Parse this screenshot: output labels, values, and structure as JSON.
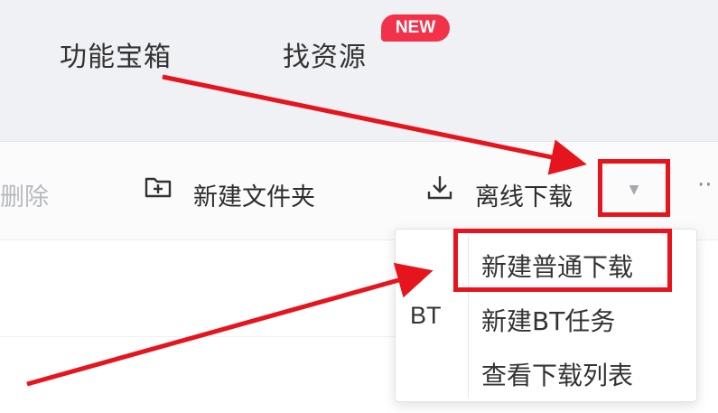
{
  "topnav": {
    "items": [
      {
        "label": "功能宝箱"
      },
      {
        "label": "找资源",
        "badge": "NEW"
      }
    ]
  },
  "toolbar": {
    "delete_label": "删除",
    "new_folder_label": "新建文件夹",
    "offline_download_label": "离线下载",
    "more_label": "··"
  },
  "dropdown": {
    "items": [
      {
        "label": "新建普通下载",
        "prefix": ""
      },
      {
        "label": "新建BT任务",
        "prefix": "BT"
      },
      {
        "label": "查看下载列表",
        "prefix": ""
      }
    ]
  },
  "annotations": {
    "highlight_color": "#e6141c"
  },
  "colors": {
    "nav_background": "#f0f1f5",
    "badge": "#f2324a"
  }
}
